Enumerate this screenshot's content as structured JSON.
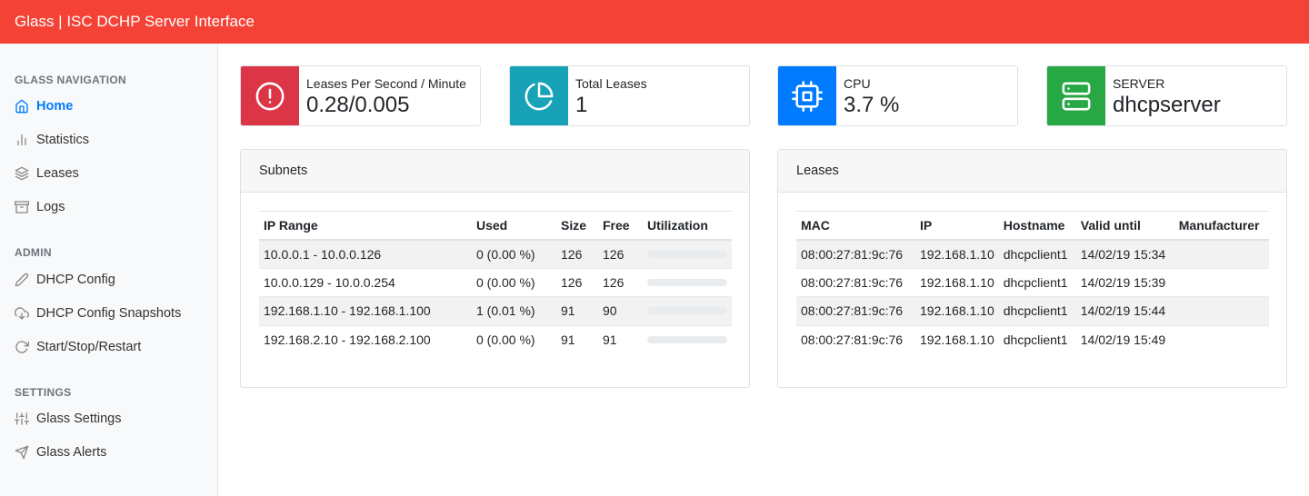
{
  "app": {
    "title": "Glass | ISC DCHP Server Interface"
  },
  "sidebar": {
    "sections": [
      {
        "heading": "GLASS NAVIGATION",
        "items": [
          {
            "label": "Home",
            "icon": "home-icon",
            "active": true
          },
          {
            "label": "Statistics",
            "icon": "bar-chart-icon"
          },
          {
            "label": "Leases",
            "icon": "layers-icon"
          },
          {
            "label": "Logs",
            "icon": "archive-icon"
          }
        ]
      },
      {
        "heading": "ADMIN",
        "items": [
          {
            "label": "DHCP Config",
            "icon": "pencil-icon"
          },
          {
            "label": "DHCP Config Snapshots",
            "icon": "cloud-download-icon"
          },
          {
            "label": "Start/Stop/Restart",
            "icon": "refresh-icon"
          }
        ]
      },
      {
        "heading": "SETTINGS",
        "items": [
          {
            "label": "Glass Settings",
            "icon": "sliders-icon"
          },
          {
            "label": "Glass Alerts",
            "icon": "send-icon"
          }
        ]
      }
    ]
  },
  "stats": [
    {
      "label": "Leases Per Second / Minute",
      "value": "0.28/0.005",
      "color": "#dc3545",
      "icon": "alert-circle-icon"
    },
    {
      "label": "Total Leases",
      "value": "1",
      "color": "#17a2b8",
      "icon": "pie-chart-icon"
    },
    {
      "label": "CPU",
      "value": "3.7 %",
      "color": "#007bff",
      "icon": "cpu-icon"
    },
    {
      "label": "SERVER",
      "value": "dhcpserver",
      "color": "#28a745",
      "icon": "server-icon"
    }
  ],
  "subnets": {
    "title": "Subnets",
    "columns": [
      "IP Range",
      "Used",
      "Size",
      "Free",
      "Utilization"
    ],
    "rows": [
      {
        "range": "10.0.0.1 - 10.0.0.126",
        "used": "0 (0.00 %)",
        "size": "126",
        "free": "126",
        "utilization": 0
      },
      {
        "range": "10.0.0.129 - 10.0.0.254",
        "used": "0 (0.00 %)",
        "size": "126",
        "free": "126",
        "utilization": 0
      },
      {
        "range": "192.168.1.10 - 192.168.1.100",
        "used": "1 (0.01 %)",
        "size": "91",
        "free": "90",
        "utilization": 0.01
      },
      {
        "range": "192.168.2.10 - 192.168.2.100",
        "used": "0 (0.00 %)",
        "size": "91",
        "free": "91",
        "utilization": 0
      }
    ]
  },
  "leases": {
    "title": "Leases",
    "columns": [
      "MAC",
      "IP",
      "Hostname",
      "Valid until",
      "Manufacturer"
    ],
    "rows": [
      {
        "mac": "08:00:27:81:9c:76",
        "ip": "192.168.1.10",
        "hostname": "dhcpclient1",
        "valid_until": "14/02/19 15:34",
        "manufacturer": ""
      },
      {
        "mac": "08:00:27:81:9c:76",
        "ip": "192.168.1.10",
        "hostname": "dhcpclient1",
        "valid_until": "14/02/19 15:39",
        "manufacturer": ""
      },
      {
        "mac": "08:00:27:81:9c:76",
        "ip": "192.168.1.10",
        "hostname": "dhcpclient1",
        "valid_until": "14/02/19 15:44",
        "manufacturer": ""
      },
      {
        "mac": "08:00:27:81:9c:76",
        "ip": "192.168.1.10",
        "hostname": "dhcpclient1",
        "valid_until": "14/02/19 15:49",
        "manufacturer": ""
      }
    ]
  }
}
